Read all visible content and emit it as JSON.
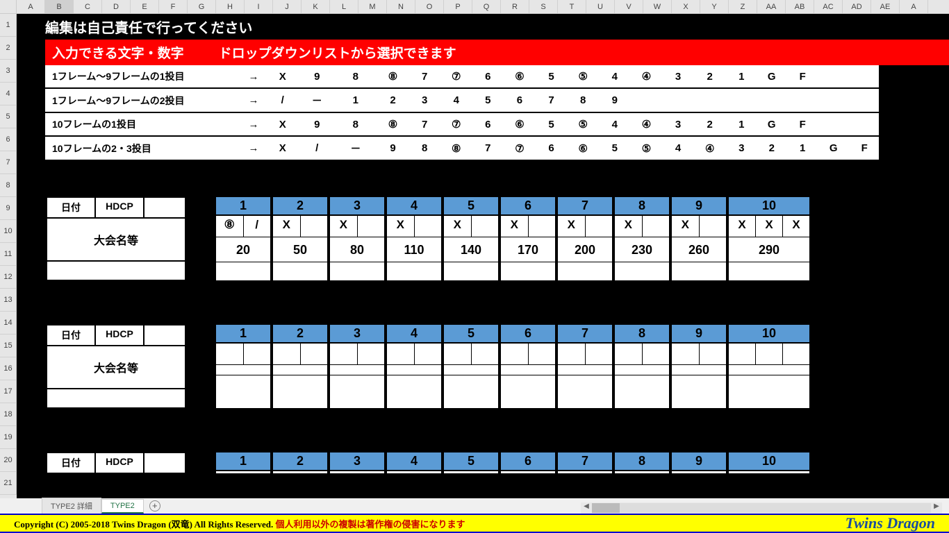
{
  "columns": [
    "A",
    "B",
    "C",
    "D",
    "E",
    "F",
    "G",
    "H",
    "I",
    "J",
    "K",
    "L",
    "M",
    "N",
    "O",
    "P",
    "Q",
    "R",
    "S",
    "T",
    "U",
    "V",
    "W",
    "X",
    "Y",
    "Z",
    "AA",
    "AB",
    "AC",
    "AD",
    "AE",
    "A"
  ],
  "rows": [
    "1",
    "2",
    "3",
    "4",
    "5",
    "6",
    "7",
    "8",
    "9",
    "10",
    "11",
    "12",
    "13",
    "14",
    "15",
    "16",
    "17",
    "18",
    "19",
    "20",
    "21"
  ],
  "header_title": "編集は自己責任で行ってください",
  "header_red_1": "入力できる文字・数字",
  "header_red_2": "ドロップダウンリストから選択できます",
  "instr": [
    {
      "label": "1フレーム～9フレームの1投目",
      "vals": [
        "→",
        "X",
        "9",
        "8",
        "⑧",
        "7",
        "⑦",
        "6",
        "⑥",
        "5",
        "⑤",
        "4",
        "④",
        "3",
        "2",
        "1",
        "G",
        "F",
        "",
        ""
      ]
    },
    {
      "label": "1フレーム～9フレームの2投目",
      "vals": [
        "→",
        "/",
        "－",
        "1",
        "2",
        "3",
        "4",
        "5",
        "6",
        "7",
        "8",
        "9",
        "",
        "",
        "",
        "",
        "",
        "",
        "",
        ""
      ]
    },
    {
      "label": "10フレームの1投目",
      "vals": [
        "→",
        "X",
        "9",
        "8",
        "⑧",
        "7",
        "⑦",
        "6",
        "⑥",
        "5",
        "⑤",
        "4",
        "④",
        "3",
        "2",
        "1",
        "G",
        "F",
        "",
        ""
      ]
    },
    {
      "label": "10フレームの2・3投目",
      "vals": [
        "→",
        "X",
        "/",
        "－",
        "9",
        "8",
        "⑧",
        "7",
        "⑦",
        "6",
        "⑥",
        "5",
        "⑤",
        "4",
        "④",
        "3",
        "2",
        "1",
        "G",
        "F"
      ]
    }
  ],
  "meta_labels": {
    "date": "日付",
    "hdcp": "HDCP",
    "event": "大会名等"
  },
  "frame_nums": [
    "1",
    "2",
    "3",
    "4",
    "5",
    "6",
    "7",
    "8",
    "9",
    "10"
  ],
  "game1": {
    "throws": [
      [
        "⑧",
        "/"
      ],
      [
        "X",
        ""
      ],
      [
        "X",
        ""
      ],
      [
        "X",
        ""
      ],
      [
        "X",
        ""
      ],
      [
        "X",
        ""
      ],
      [
        "X",
        ""
      ],
      [
        "X",
        ""
      ],
      [
        "X",
        ""
      ],
      [
        "X",
        "X",
        "X"
      ]
    ],
    "scores": [
      "20",
      "50",
      "80",
      "110",
      "140",
      "170",
      "200",
      "230",
      "260",
      "290"
    ]
  },
  "game2": {
    "throws": [
      [
        "",
        ""
      ],
      [
        "",
        ""
      ],
      [
        "",
        ""
      ],
      [
        "",
        ""
      ],
      [
        "",
        ""
      ],
      [
        "",
        ""
      ],
      [
        "",
        ""
      ],
      [
        "",
        ""
      ],
      [
        "",
        ""
      ],
      [
        "",
        "",
        ""
      ]
    ],
    "scores": [
      "",
      "",
      "",
      "",
      "",
      "",
      "",
      "",
      "",
      ""
    ]
  },
  "tabs": {
    "t1": "TYPE2 詳細",
    "t2": "TYPE2"
  },
  "footer": {
    "c1": "Copyright (C) 2005-2018 Twins Dragon (双竜)  All Rights Reserved.  ",
    "c2": "個人利用以外の複製は著作権の侵害になります",
    "logo": "Twins Dragon"
  }
}
